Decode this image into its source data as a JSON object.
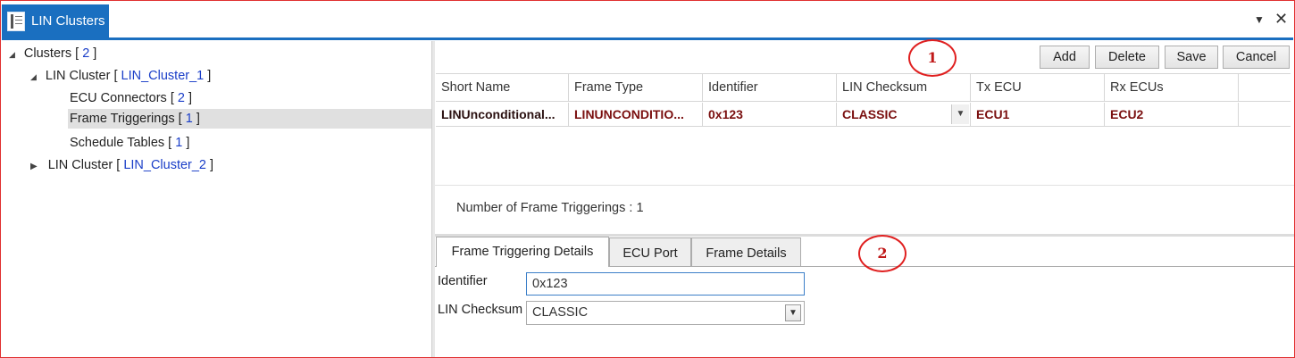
{
  "window": {
    "tab_title": "LIN Clusters",
    "dropdown_glyph": "▼",
    "close_glyph": "✕"
  },
  "tree": {
    "root": {
      "label": "Clusters [ ",
      "count": "2",
      "suffix": " ]"
    },
    "cluster1": {
      "label": "LIN Cluster [ ",
      "link": "LIN_Cluster_1",
      "suffix": " ]"
    },
    "ecu_connectors": {
      "label": "ECU Connectors [ ",
      "count": "2",
      "suffix": " ]"
    },
    "frame_triggerings": {
      "label": "Frame Triggerings [ ",
      "count": "1",
      "suffix": " ]"
    },
    "schedule_tables": {
      "label": "Schedule Tables [ ",
      "count": "1",
      "suffix": " ]"
    },
    "cluster2": {
      "label": "LIN Cluster [ ",
      "link": "LIN_Cluster_2",
      "suffix": " ]"
    }
  },
  "toolbar": {
    "add": "Add",
    "delete": "Delete",
    "save": "Save",
    "cancel": "Cancel"
  },
  "grid": {
    "columns": [
      "Short Name",
      "Frame Type",
      "Identifier",
      "LIN Checksum",
      "Tx ECU",
      "Rx ECUs"
    ],
    "rows": [
      [
        "LINUnconditional...",
        "LINUNCONDITIO...",
        "0x123",
        "CLASSIC",
        "ECU1",
        "ECU2"
      ]
    ]
  },
  "count_text": "Number of Frame Triggerings : 1",
  "detail_tabs": [
    "Frame Triggering Details",
    "ECU Port",
    "Frame Details"
  ],
  "details": {
    "identifier_label": "Identifier",
    "identifier_value": "0x123",
    "checksum_label": "LIN Checksum",
    "checksum_value": "CLASSIC"
  },
  "callouts": [
    "1",
    "2"
  ],
  "colors": {
    "accent": "#1a6fc0",
    "link": "#1a3ec8",
    "row_text": "#7a0f0f",
    "callout": "#e02020"
  }
}
